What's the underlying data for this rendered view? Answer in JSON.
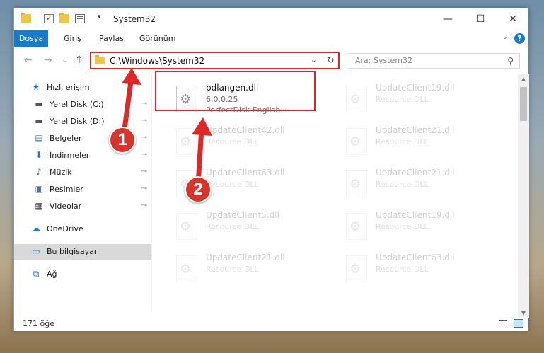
{
  "window": {
    "title": "System32",
    "minimize_glyph": "—",
    "maximize_glyph": "☐",
    "close_glyph": "✕",
    "quick_access_dropdown": "▾"
  },
  "ribbon": {
    "tabs": [
      "Dosya",
      "Giriş",
      "Paylaş",
      "Görünüm"
    ],
    "collapse_glyph": "⌄",
    "help_glyph": "?"
  },
  "nav": {
    "back_glyph": "←",
    "forward_glyph": "→",
    "recent_glyph": "⌄",
    "up_glyph": "↑",
    "address": "C:\\Windows\\System32",
    "address_dropdown_glyph": "⌄",
    "refresh_glyph": "↻",
    "search_placeholder": "Ara: System32",
    "search_glyph": "⚲"
  },
  "sidebar": {
    "items": [
      {
        "label": "Hızlı erişim",
        "icon": "star-icon",
        "glyph": "★",
        "color": "#1979ca",
        "pinned": false
      },
      {
        "label": "Yerel Disk (C:)",
        "icon": "drive-icon",
        "glyph": "▬",
        "color": "#555555",
        "pinned": true
      },
      {
        "label": "Yerel Disk (D:)",
        "icon": "drive-icon",
        "glyph": "▬",
        "color": "#555555",
        "pinned": true
      },
      {
        "label": "Belgeler",
        "icon": "document-icon",
        "glyph": "▤",
        "color": "#4a6ea8",
        "pinned": true
      },
      {
        "label": "İndirmeler",
        "icon": "download-icon",
        "glyph": "⬇",
        "color": "#1979ca",
        "pinned": true
      },
      {
        "label": "Müzik",
        "icon": "music-icon",
        "glyph": "♪",
        "color": "#1979ca",
        "pinned": true
      },
      {
        "label": "Resimler",
        "icon": "picture-icon",
        "glyph": "▣",
        "color": "#4a6ea8",
        "pinned": true
      },
      {
        "label": "Videolar",
        "icon": "video-icon",
        "glyph": "▦",
        "color": "#444444",
        "pinned": true
      },
      {
        "label": "OneDrive",
        "icon": "cloud-icon",
        "glyph": "☁",
        "color": "#1979ca",
        "pinned": false
      },
      {
        "label": "Bu bilgisayar",
        "icon": "computer-icon",
        "glyph": "▭",
        "color": "#1979ca",
        "pinned": false,
        "selected": true
      },
      {
        "label": "Ağ",
        "icon": "network-icon",
        "glyph": "⧉",
        "color": "#1979ca",
        "pinned": false
      }
    ],
    "pin_glyph": "📌"
  },
  "files": [
    {
      "name": "pdlangen.dll",
      "type": "6.0.0.25",
      "desc": "PerfectDisk English...",
      "faded": false
    },
    {
      "name": "UpdateClient19.dll",
      "type": "Resource DLL",
      "desc": "",
      "faded": true
    },
    {
      "name": "UpdateClient42.dll",
      "type": "Resource DLL",
      "desc": "",
      "faded": true
    },
    {
      "name": "UpdateClient21.dll",
      "type": "Resource DLL",
      "desc": "",
      "faded": true
    },
    {
      "name": "UpdateClient63.dll",
      "type": "Resource DLL",
      "desc": "",
      "faded": true
    },
    {
      "name": "UpdateClient21.dll",
      "type": "Resource DLL",
      "desc": "",
      "faded": true
    },
    {
      "name": "UpdateClient5.dll",
      "type": "Resource DLL",
      "desc": "",
      "faded": true
    },
    {
      "name": "UpdateClient19.dll",
      "type": "Resource DLL",
      "desc": "",
      "faded": true
    },
    {
      "name": "UpdateClient21.dll",
      "type": "Resource DLL",
      "desc": "",
      "faded": true
    },
    {
      "name": "UpdateClient63.dll",
      "type": "Resource DLL",
      "desc": "",
      "faded": true
    }
  ],
  "status": {
    "count": "171 öğe"
  },
  "annotations": {
    "step1": "1",
    "step2": "2",
    "color": "#e02626"
  }
}
